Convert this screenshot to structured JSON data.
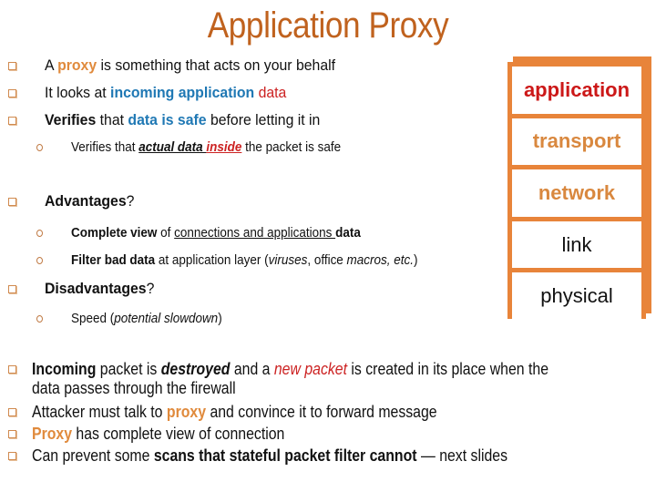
{
  "slide": {
    "title": "Application Proxy"
  },
  "top_bullets": [
    {
      "parts": [
        "A ",
        "proxy",
        " is something that acts on your behalf"
      ]
    },
    {
      "parts": [
        "It looks at ",
        "incoming application",
        " ",
        "data"
      ]
    },
    {
      "parts": [
        "Verifies",
        " that ",
        "data is safe",
        " before letting it in"
      ]
    }
  ],
  "verify_sub": {
    "parts": [
      "Verifies that ",
      "actual data ",
      "inside",
      " the packet is safe"
    ]
  },
  "advantages": {
    "heading": "Advantages",
    "q": "?",
    "items": [
      {
        "parts": [
          "Complete view",
          " of ",
          "connections and applications ",
          "data"
        ]
      },
      {
        "parts": [
          "Filter bad data",
          " at application layer (",
          "viruses",
          ", office ",
          "macros, etc.",
          ")"
        ]
      }
    ]
  },
  "disadvantages": {
    "heading": "Disadvantages",
    "q": "?",
    "items": [
      {
        "parts": [
          "Speed (",
          "potential slowdown",
          ")"
        ]
      }
    ]
  },
  "bottom_bullets": [
    {
      "parts": [
        "Incoming",
        " packet is ",
        "destroyed",
        " and a ",
        "new packet",
        " is created in its place when the"
      ],
      "cont": "data passes through the firewall"
    },
    {
      "parts": [
        "Attacker must talk to ",
        "proxy",
        " and convince it to forward message"
      ]
    },
    {
      "parts": [
        "Proxy",
        " has complete view of connection"
      ]
    },
    {
      "parts": [
        "Can prevent some ",
        "scans that stateful packet filter cannot",
        " — next slides"
      ]
    }
  ],
  "protocol_stack": {
    "layers": [
      "application",
      "transport",
      "network",
      "link",
      "physical"
    ],
    "highlighted": "application",
    "colors": {
      "border": "#e8843a",
      "highlight": "#cc1818",
      "accent": "#d9883f"
    }
  },
  "colors": {
    "title": "#c0621e",
    "proxy": "#e08a3c",
    "emphasis_blue": "#1f78b4",
    "emphasis_red": "#cc2222"
  }
}
